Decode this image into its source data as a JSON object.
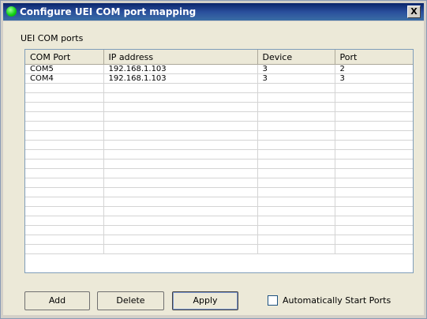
{
  "window": {
    "title": "Configure UEI COM port mapping",
    "close_label": "X"
  },
  "group": {
    "label": "UEI COM ports"
  },
  "table": {
    "headers": [
      "COM Port",
      "IP address",
      "Device",
      "Port"
    ],
    "rows": [
      [
        "COM5",
        "192.168.1.103",
        "3",
        "2"
      ],
      [
        "COM4",
        "192.168.1.103",
        "3",
        "3"
      ]
    ]
  },
  "buttons": {
    "add": "Add",
    "delete": "Delete",
    "apply": "Apply"
  },
  "checkbox": {
    "label": "Automatically Start Ports",
    "checked": false
  }
}
